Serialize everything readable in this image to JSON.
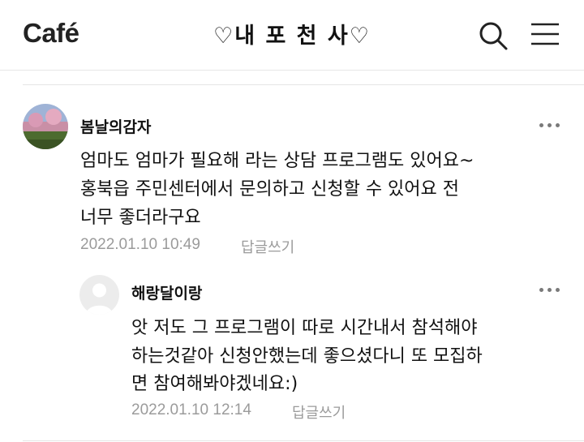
{
  "header": {
    "logo": "Café",
    "title": "♡내 포 천 사♡",
    "search_icon": "search-icon",
    "menu_icon": "hamburger-menu-icon"
  },
  "comments": [
    {
      "author": "봄날의감자",
      "avatar": "landscape-photo-avatar",
      "lines": [
        "엄마도 엄마가 필요해 라는 상담 프로그램도 있어요~",
        "홍북읍 주민센터에서 문의하고 신청할 수 있어요 전",
        "너무 좋더라구요"
      ],
      "date": "2022.01.10 10:49",
      "reply_label": "답글쓰기"
    },
    {
      "author": "해랑달이랑",
      "avatar": "default-user-avatar",
      "lines": [
        "앗 저도 그 프로그램이 따로 시간내서 참석해야",
        "하는것같아 신청안했는데 좋으셨다니 또 모집하",
        "면 참여해봐야겠네요:)"
      ],
      "date": "2022.01.10 12:14",
      "reply_label": "답글쓰기"
    }
  ],
  "colors": {
    "text": "#111111",
    "meta": "#9b9b9b",
    "divider": "#e6e6e6"
  }
}
